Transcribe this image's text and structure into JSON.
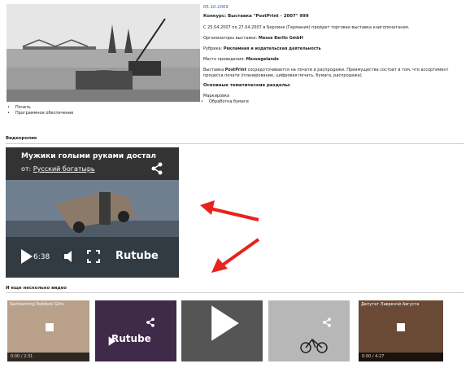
{
  "article": {
    "date": "05.10.2009",
    "title": "Конкурс: Выставка \"PostPrint - 2007\" 999",
    "line1": "С 25.04.2007 по 27.04.2007 в Берлине (Германия) пройдет торговая выставка книгопечатания.",
    "organizer_label": "Организаторы выставки:",
    "organizer_value": "Messe Berlin GmbH",
    "category_label": "Рубрика:",
    "category_value": "Рекламная и издательская деятельность",
    "venue_label": "Место проведения:",
    "venue_value": "Messegelande",
    "desc_prefix": "Выставка",
    "desc_name": "PostPrint",
    "desc_rest": "сосредоточивается на почати и распродажи. Преимущества состоит в том, что ассортимент процесса почати (планирование, цифровая печать, бумага, распродажа).",
    "sections_heading": "Основные тематические разделы:",
    "sections": [
      "Маркировка",
      "Обработка бумаги"
    ],
    "bullets_left": [
      "Почать",
      "Программное обеспечение"
    ]
  },
  "video_section": {
    "heading": "Видеоролик",
    "main_video": {
      "title": "Мужики голыми руками достал",
      "from_label": "от:",
      "channel": "Русский богатырь",
      "time": "6:38",
      "brand": "Rutube"
    }
  },
  "more_videos": {
    "heading": "И еще несколько видео",
    "thumbs": [
      {
        "title": "Sachsenring Paddock Girls",
        "time": "0:00 / 2:31"
      },
      {
        "title": "",
        "time": "",
        "brand": "Rutube"
      },
      {
        "title": "",
        "time": ""
      },
      {
        "title": "",
        "time": ""
      },
      {
        "title": "Депутат Лавренчй Августа",
        "time": "0:00 / 4:27"
      }
    ]
  },
  "colors": {
    "arrow": "#e8231c",
    "link": "#2a5db0"
  }
}
